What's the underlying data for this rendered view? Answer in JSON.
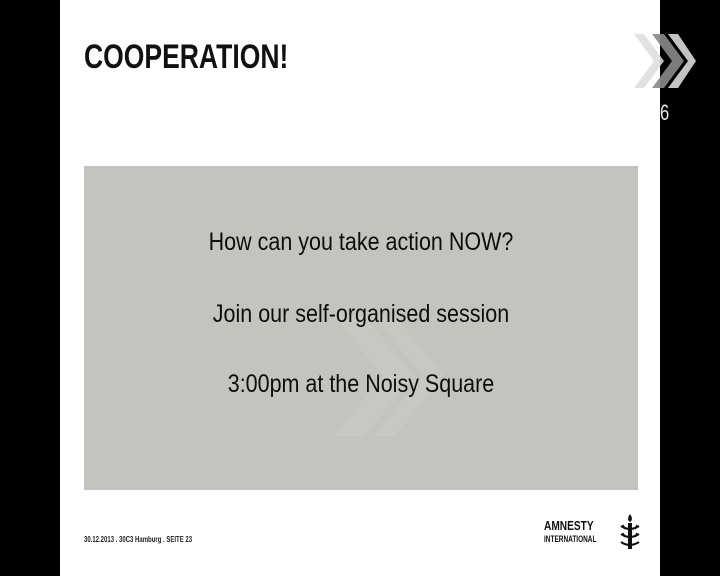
{
  "slide": {
    "title": "COOPERATION!",
    "lines": [
      "How can you take action NOW?",
      "Join our self-organised session",
      "3:00pm at the Noisy Square"
    ],
    "footer": "30.12.2013 . 30C3 Hamburg . SEITE 23",
    "logo_line1": "AMNESTY",
    "logo_line2": "INTERNATIONAL"
  },
  "overlay": {
    "number": "6"
  },
  "colors": {
    "background": "#000000",
    "slide": "#ffffff",
    "content_box": "#c5c3bd",
    "text": "#111111"
  },
  "icons": {
    "corner": "30c3-chevron-logo-icon",
    "amnesty": "candle-in-barbed-wire-icon"
  }
}
